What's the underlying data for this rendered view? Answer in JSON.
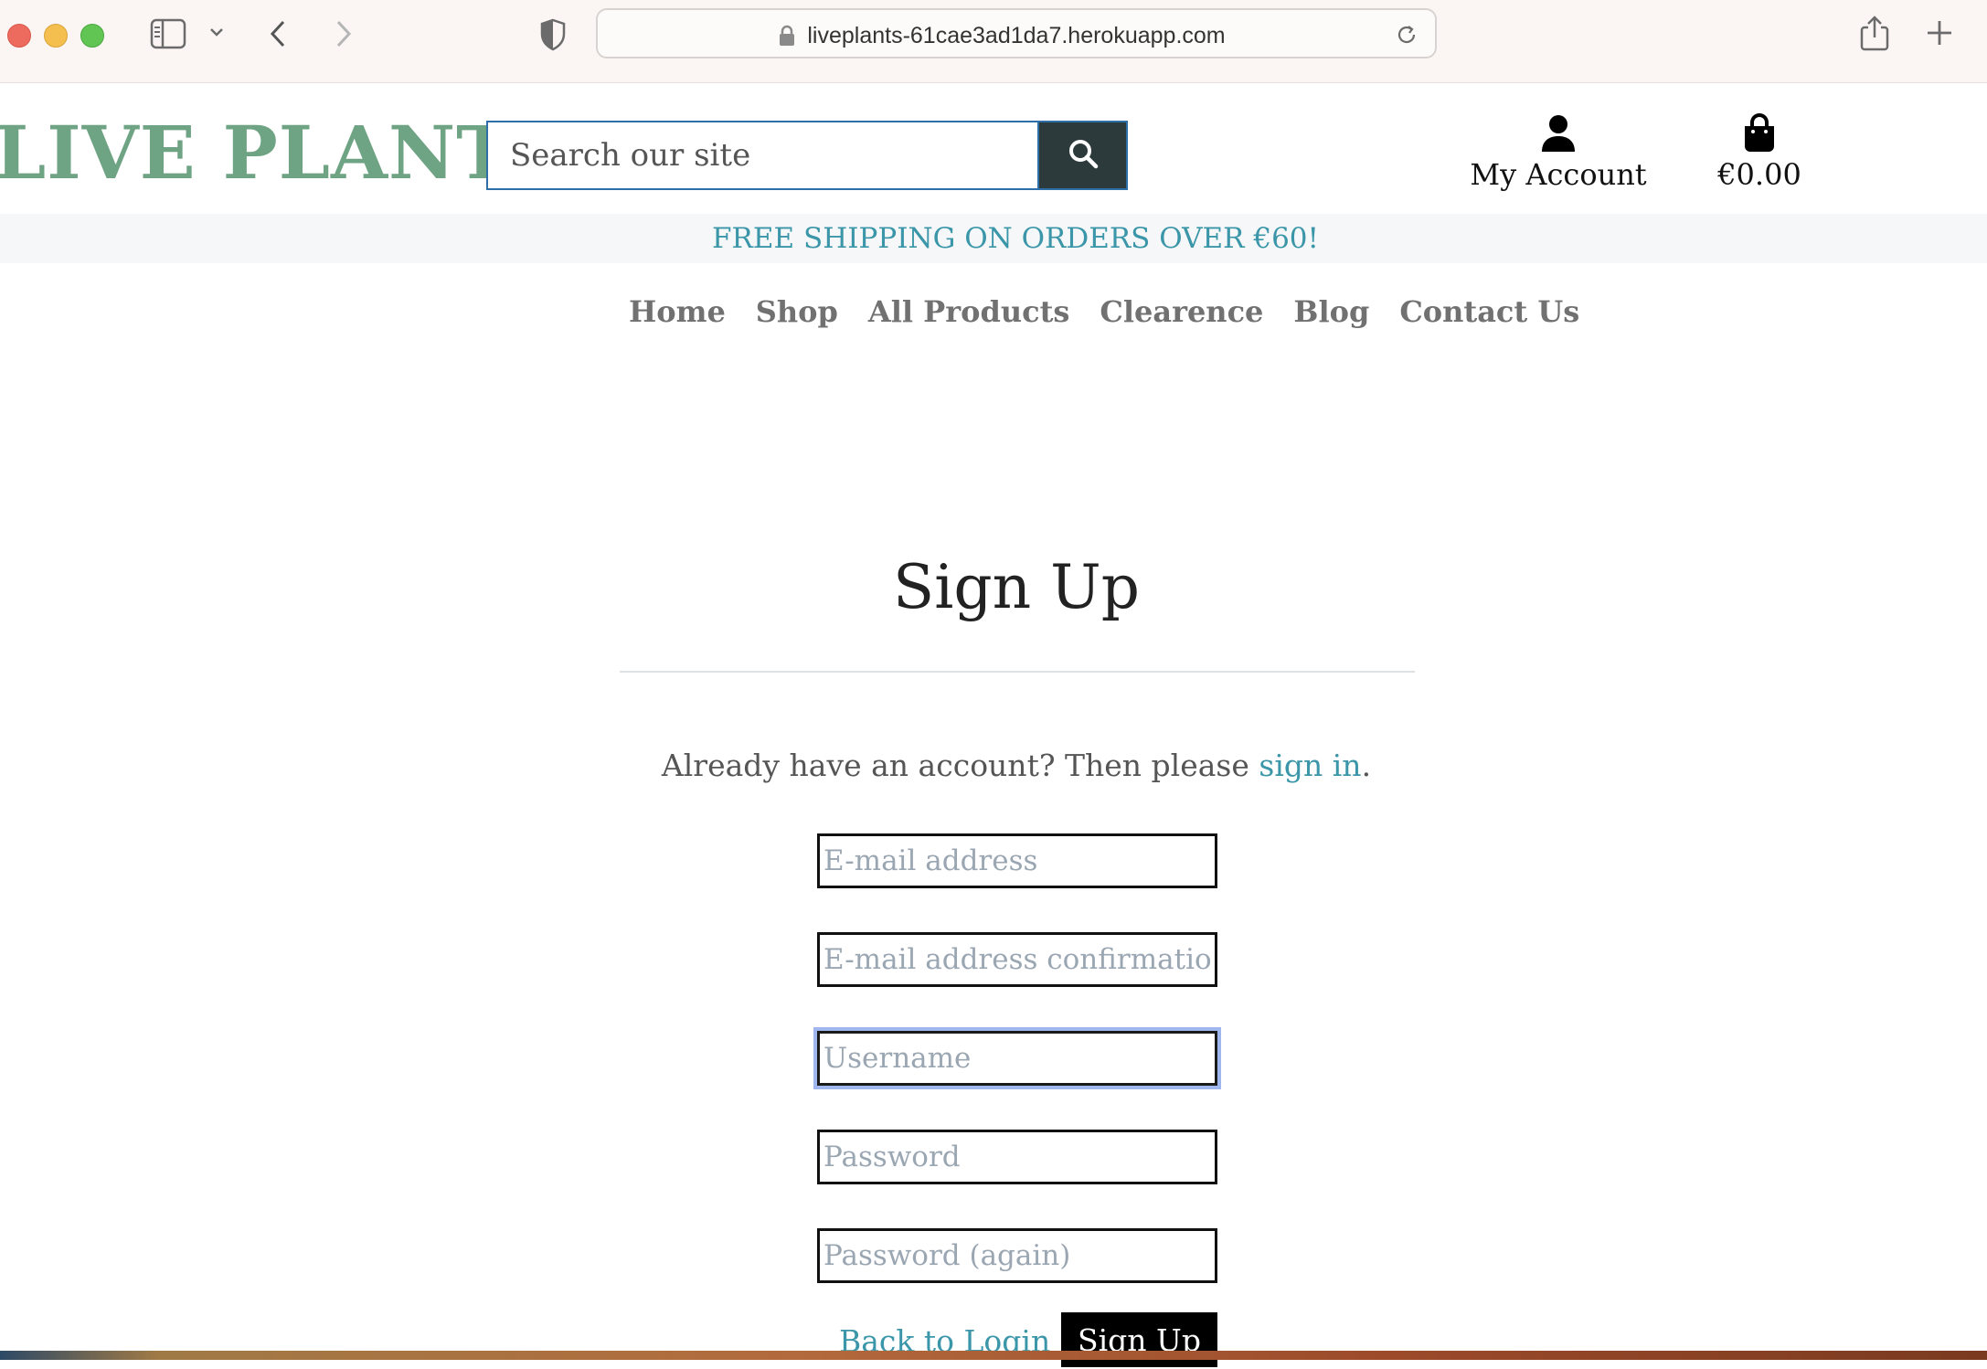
{
  "browser": {
    "url": "liveplants-61cae3ad1da7.herokuapp.com"
  },
  "header": {
    "brand": "LIVE PLANTS",
    "search_placeholder": "Search our site",
    "account_label": "My Account",
    "bag_total": "€0.00"
  },
  "promo": {
    "text": "FREE SHIPPING ON ORDERS OVER €60!"
  },
  "nav": {
    "items": [
      "Home",
      "Shop",
      "All Products",
      "Clearence",
      "Blog",
      "Contact Us"
    ]
  },
  "signup": {
    "title": "Sign Up",
    "already_text": "Already have an account? Then please",
    "sign_in_link": "sign in",
    "period": ".",
    "fields": {
      "email": "E-mail address",
      "email_confirm": "E-mail address confirmation",
      "username": "Username",
      "password": "Password",
      "password_again": "Password (again)"
    },
    "back_link": "Back to Login",
    "submit_label": "Sign Up"
  },
  "colors": {
    "brand_green": "#6ea383",
    "accent_teal": "#3a96a8",
    "search_button": "#2c3a3c"
  },
  "icons": [
    "sidebar-icon",
    "chevron-down-icon",
    "back-arrow-icon",
    "forward-arrow-icon",
    "shield-icon",
    "lock-icon",
    "reload-icon",
    "share-icon",
    "plus-icon",
    "search-icon",
    "user-icon",
    "shopping-bag-icon"
  ]
}
